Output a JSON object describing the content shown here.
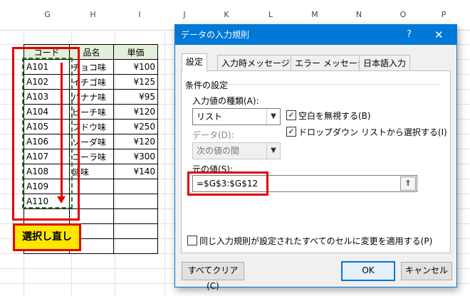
{
  "sheet": {
    "columns": [
      "G",
      "H",
      "I",
      "J",
      "K",
      "L",
      "M",
      "N",
      "O",
      "P"
    ],
    "header": [
      "コード",
      "品名",
      "単価"
    ],
    "rows": [
      [
        "A101",
        "チョコ味",
        "¥100"
      ],
      [
        "A102",
        "イチゴ味",
        "¥125"
      ],
      [
        "A103",
        "バナナ味",
        "¥95"
      ],
      [
        "A104",
        "ピーチ味",
        "¥120"
      ],
      [
        "A105",
        "ブドウ味",
        "¥250"
      ],
      [
        "A106",
        "ソーダ味",
        "¥120"
      ],
      [
        "A107",
        "コーラ味",
        "¥300"
      ],
      [
        "A108",
        "謎味",
        "¥140"
      ],
      [
        "A109",
        "",
        ""
      ],
      [
        "A110",
        "",
        ""
      ],
      [
        "",
        "",
        ""
      ],
      [
        "",
        "",
        ""
      ],
      [
        "",
        "",
        ""
      ]
    ]
  },
  "annotation": {
    "callout": "選択し直し",
    "accent": "#e00000",
    "callout_bg": "#ffe600"
  },
  "dialog": {
    "title": "データの入力規則",
    "help": "?",
    "close": "✕",
    "tabs": [
      "設定",
      "入力時メッセージ",
      "エラー メッセージ",
      "日本語入力"
    ],
    "group_label": "条件の設定",
    "type_label": "入力値の種類(A):",
    "type_value": "リスト",
    "data_label": "データ(D):",
    "data_value": "次の値の間",
    "ignore_blank": "空白を無視する(B)",
    "dropdown": "ドロップダウン リストから選択する(I)",
    "source_label": "元の値(S):",
    "source_value": "=$G$3:$G$12",
    "apply_all": "同じ入力規則が設定されたすべてのセルに変更を適用する(P)",
    "clear_all": "すべてクリア(C)",
    "ok": "OK",
    "cancel": "キャンセル",
    "accent": "#0078d7"
  }
}
